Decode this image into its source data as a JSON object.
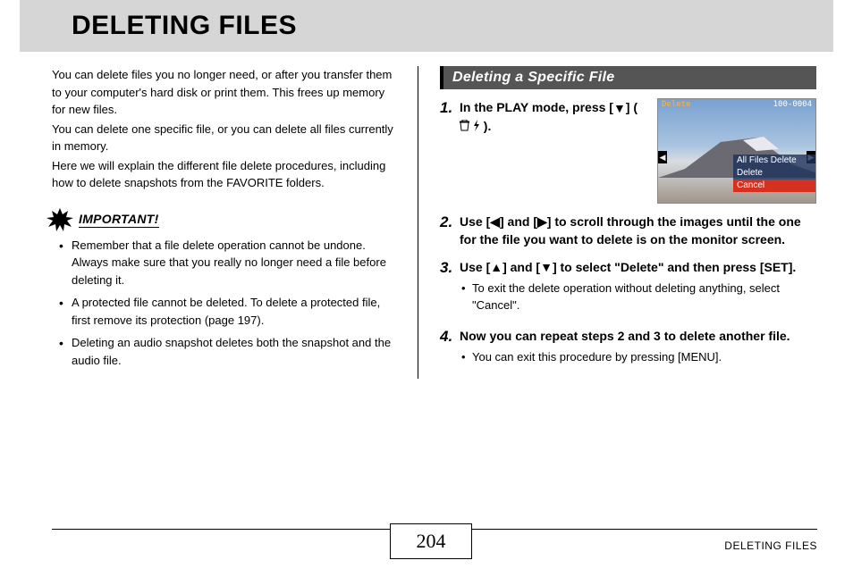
{
  "header": {
    "title": "DELETING FILES"
  },
  "intro": {
    "p1": "You can delete files you no longer need, or after you transfer them to your computer's hard disk or print them. This frees up memory for new files.",
    "p2": "You can delete one specific file, or you can delete all files currently in memory.",
    "p3": "Here we will explain the different file delete procedures, including how to delete snapshots from the FAVORITE folders."
  },
  "important": {
    "label": "IMPORTANT!",
    "items": [
      "Remember that a file delete operation cannot be undone. Always make sure that you really no longer need a file before deleting it.",
      "A protected file cannot be deleted. To delete a protected file, first remove its protection (page 197).",
      "Deleting an audio snapshot deletes both the snapshot and the audio file."
    ]
  },
  "section": {
    "title": "Deleting a Specific File"
  },
  "steps": {
    "s1": {
      "num": "1.",
      "text_a": "In the PLAY mode, press [",
      "text_b": "] ( ",
      "text_c": " )."
    },
    "s2": {
      "num": "2.",
      "text": "Use [◀] and [▶] to scroll through the images until the one for the file you want to delete is on the monitor screen."
    },
    "s3": {
      "num": "3.",
      "text": "Use [▲] and [▼] to select \"Delete\" and then press [SET].",
      "sub": "To exit the delete operation without deleting anything, select \"Cancel\"."
    },
    "s4": {
      "num": "4.",
      "text": "Now you can repeat steps 2 and 3 to delete another file.",
      "sub": "You can exit this procedure by pressing [MENU]."
    }
  },
  "screenshot": {
    "top_left": "Delete",
    "top_right": "100-0004",
    "menu": [
      "All Files Delete",
      "Delete",
      "Cancel"
    ]
  },
  "footer": {
    "page": "204",
    "label": "DELETING FILES"
  }
}
